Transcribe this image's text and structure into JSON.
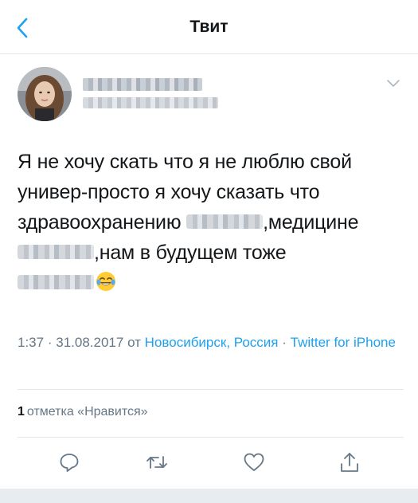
{
  "navbar": {
    "title": "Твит",
    "back_icon": "chevron-left-icon"
  },
  "tweet": {
    "text_lines": [
      "Я не хочу скать что я не люблю свой",
      "универ-просто я хочу сказать что",
      [
        "здравоохранению ",
        ",медицине"
      ],
      [
        ",нам в будущем тоже"
      ],
      []
    ],
    "emoji": "face-with-tears-of-joy-emoji",
    "time": "1:37",
    "date": "31.08.2017",
    "from_word": "от",
    "location": "Новосибирск, Россия",
    "client": "Twitter for iPhone",
    "likes_count": "1",
    "likes_label": "отметка «Нравится»"
  },
  "actions": {
    "reply_icon": "reply-icon",
    "retweet_icon": "retweet-icon",
    "like_icon": "heart-icon",
    "share_icon": "share-icon"
  },
  "colors": {
    "accent": "#1da1f2",
    "text": "#14171a",
    "secondary": "#657786",
    "divider": "#e1e8ed"
  }
}
